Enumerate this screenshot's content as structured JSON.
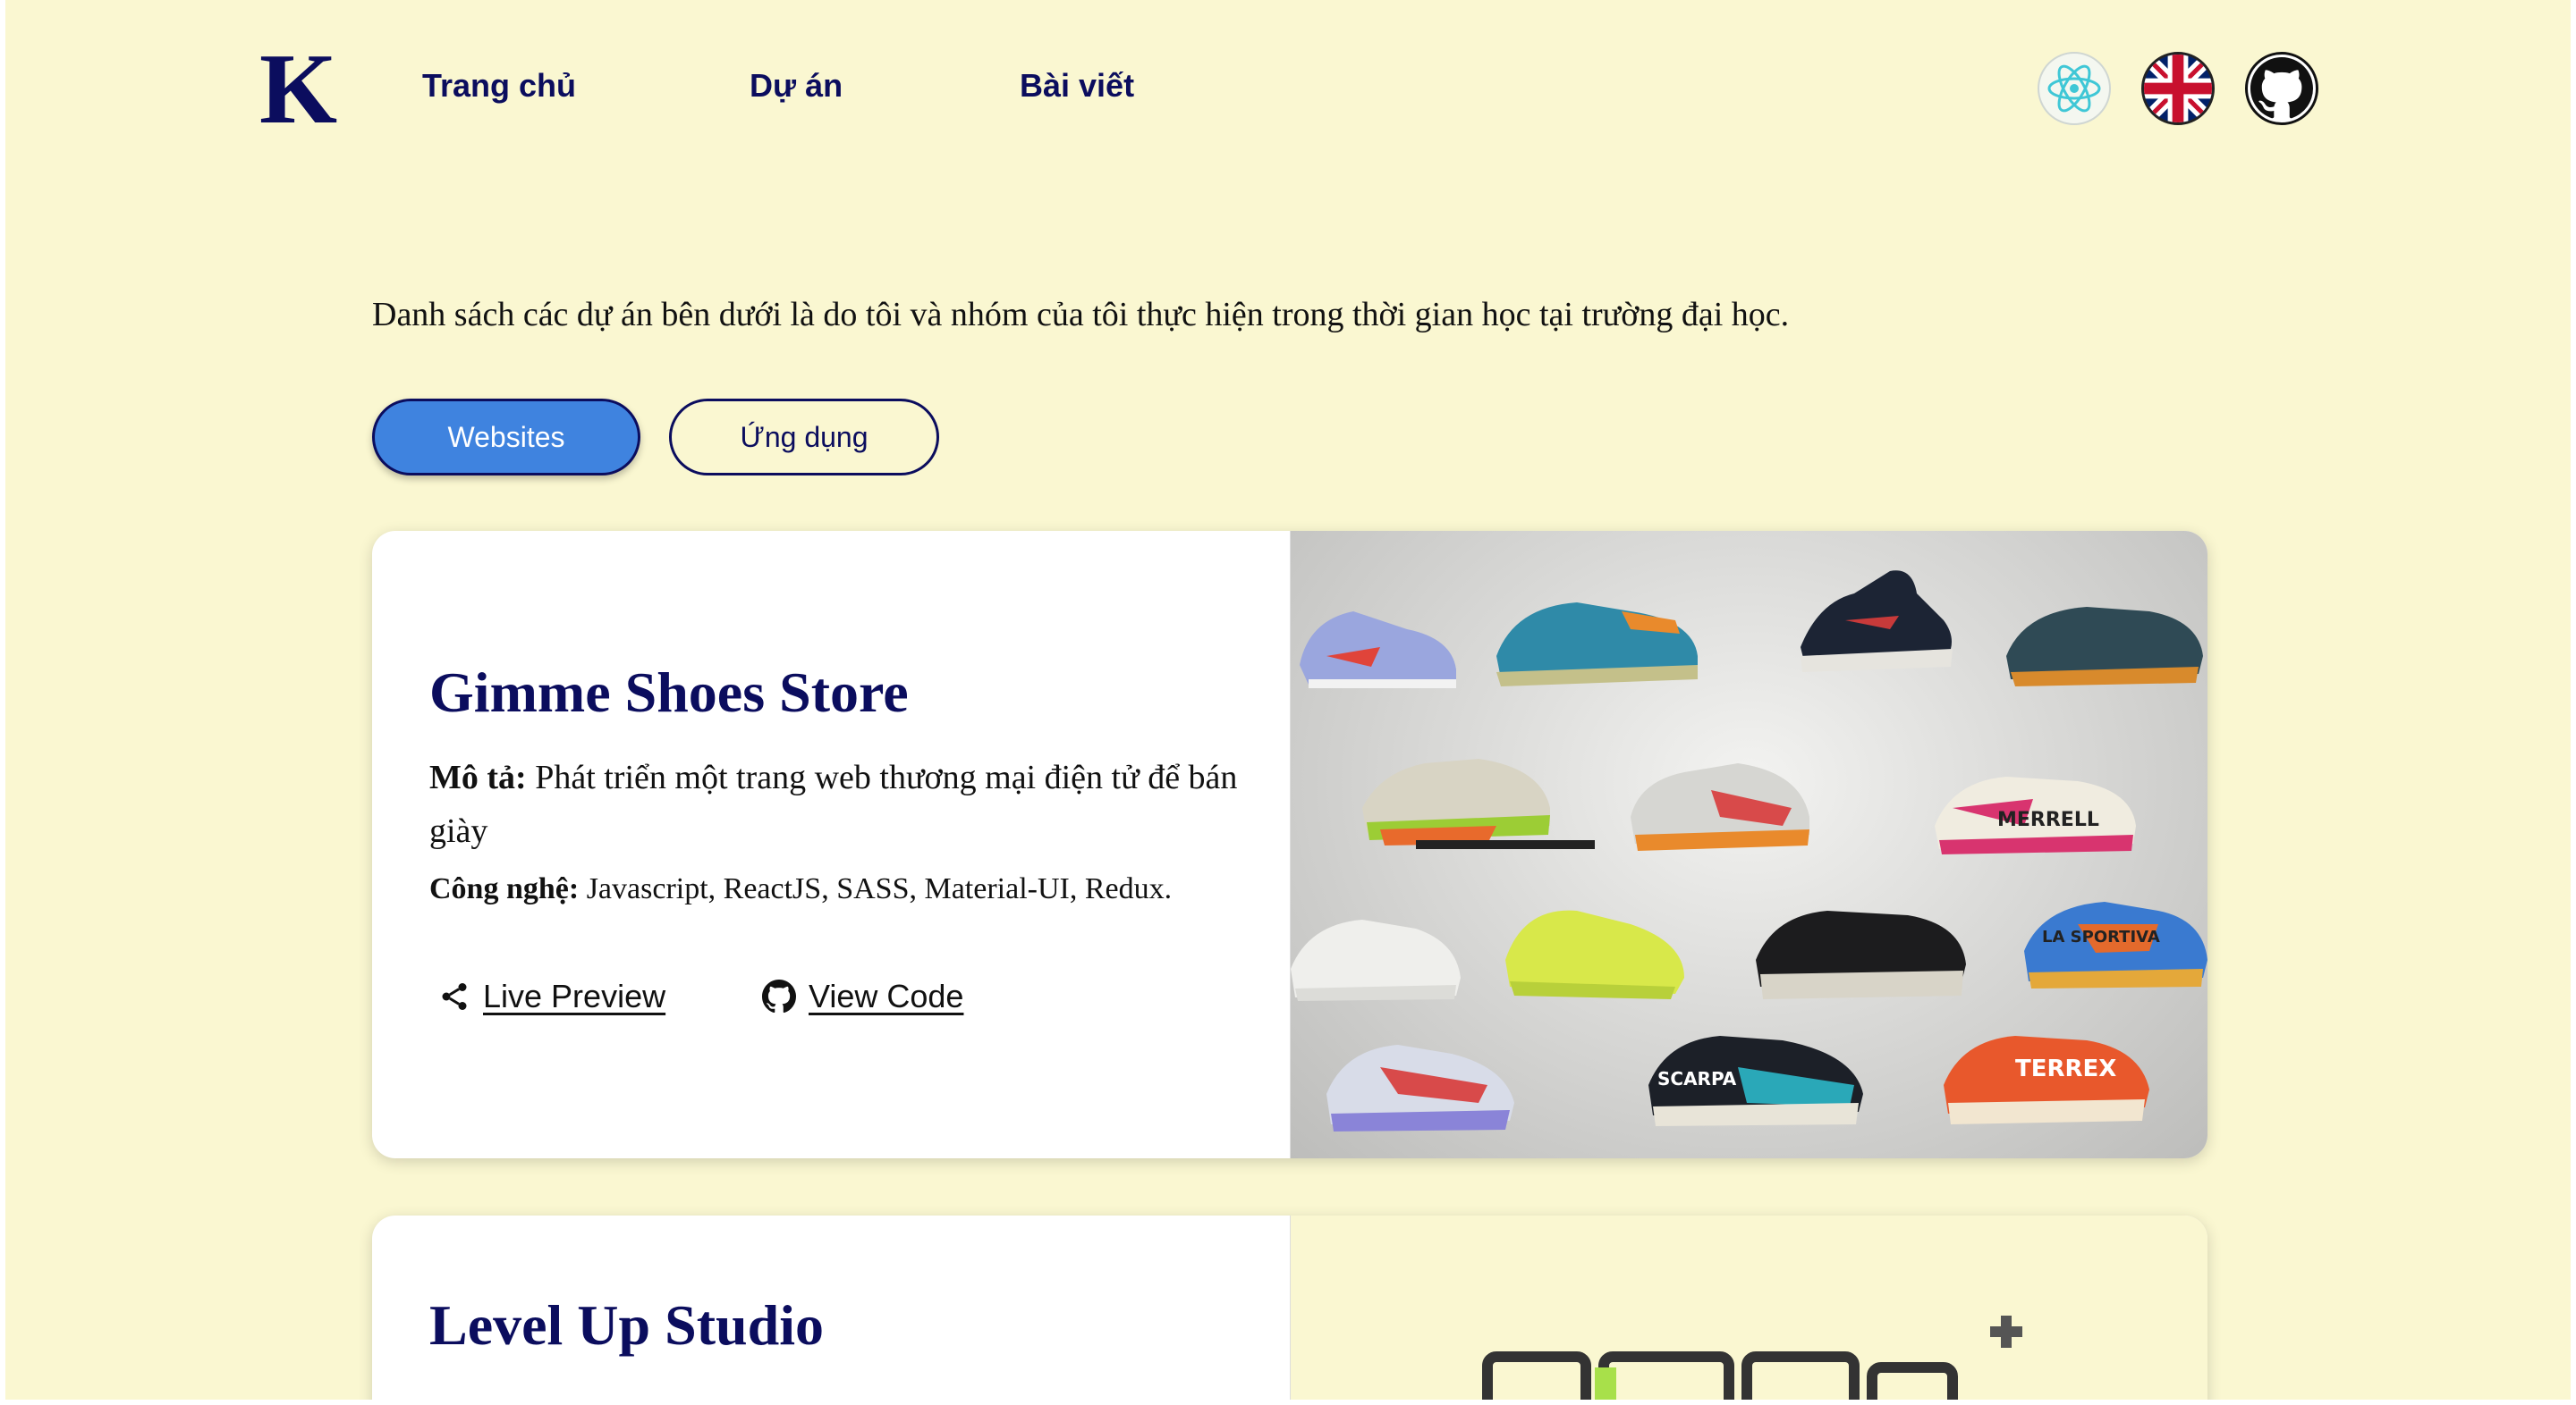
{
  "header": {
    "logo": "K",
    "nav": [
      "Trang chủ",
      "Dự án",
      "Bài viết"
    ],
    "icons": [
      "react-icon",
      "uk-flag-icon",
      "github-icon"
    ]
  },
  "intro": "Danh sách các dự án bên dưới là do tôi và nhóm của tôi thực hiện trong thời gian học tại trường đại học.",
  "tabs": [
    {
      "label": "Websites",
      "active": true
    },
    {
      "label": "Ứng dụng",
      "active": false
    }
  ],
  "projects": [
    {
      "title": "Gimme Shoes Store",
      "desc_label": "Mô tả:",
      "desc": "Phát triển một trang web thương mại điện tử để bán giày",
      "tech_label": "Công nghệ:",
      "tech": "Javascript, ReactJS, SASS, Material-UI, Redux.",
      "preview_label": "Live Preview",
      "code_label": "View Code"
    },
    {
      "title": "Level Up Studio"
    }
  ],
  "colors": {
    "background": "#faf7d1",
    "navy": "#0b0d5e",
    "accent": "#3f83df",
    "card": "#ffffff"
  }
}
